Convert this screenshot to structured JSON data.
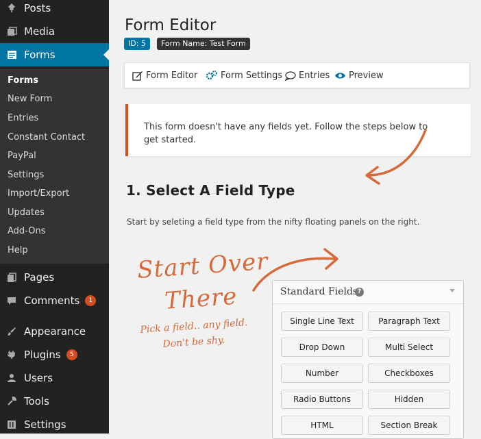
{
  "sidebar": {
    "top_items": [
      {
        "label": "Posts",
        "icon": "pin-icon"
      },
      {
        "label": "Media",
        "icon": "media-icon"
      },
      {
        "label": "Forms",
        "icon": "forms-icon"
      }
    ],
    "submenu": [
      "Forms",
      "New Form",
      "Entries",
      "Constant Contact",
      "PayPal",
      "Settings",
      "Import/Export",
      "Updates",
      "Add-Ons",
      "Help"
    ],
    "bottom_items": [
      {
        "label": "Pages",
        "icon": "pages-icon"
      },
      {
        "label": "Comments",
        "icon": "comments-icon",
        "badge": "1"
      },
      {
        "label": "Appearance",
        "icon": "brush-icon"
      },
      {
        "label": "Plugins",
        "icon": "plugin-icon",
        "badge": "5"
      },
      {
        "label": "Users",
        "icon": "users-icon"
      },
      {
        "label": "Tools",
        "icon": "wrench-icon"
      },
      {
        "label": "Settings",
        "icon": "settings-icon"
      }
    ]
  },
  "header": {
    "title": "Form Editor",
    "id_tag": "ID: 5",
    "name_tag": "Form Name: Test Form"
  },
  "toolbar": {
    "items": [
      "Form Editor",
      "Form Settings",
      "Entries",
      "Preview"
    ]
  },
  "notice": {
    "text": "This form doesn't have any fields yet. Follow the steps below to get started."
  },
  "step": {
    "heading": "1. Select A Field Type",
    "intro": "Start by seleting a field type from the nifty floating panels on the right."
  },
  "handwritten": {
    "line1": "Start Over",
    "line2": "There",
    "line3": "Pick a field.. any field.",
    "line4": "Don't be shy."
  },
  "panel": {
    "title": "Standard Fields",
    "help_glyph": "?",
    "buttons": [
      "Single Line Text",
      "Paragraph Text",
      "Drop Down",
      "Multi Select",
      "Number",
      "Checkboxes",
      "Radio Buttons",
      "Hidden",
      "HTML",
      "Section Break"
    ]
  },
  "colors": {
    "accent": "#0074a2",
    "orange": "#d54e21",
    "sidebar": "#222222"
  }
}
